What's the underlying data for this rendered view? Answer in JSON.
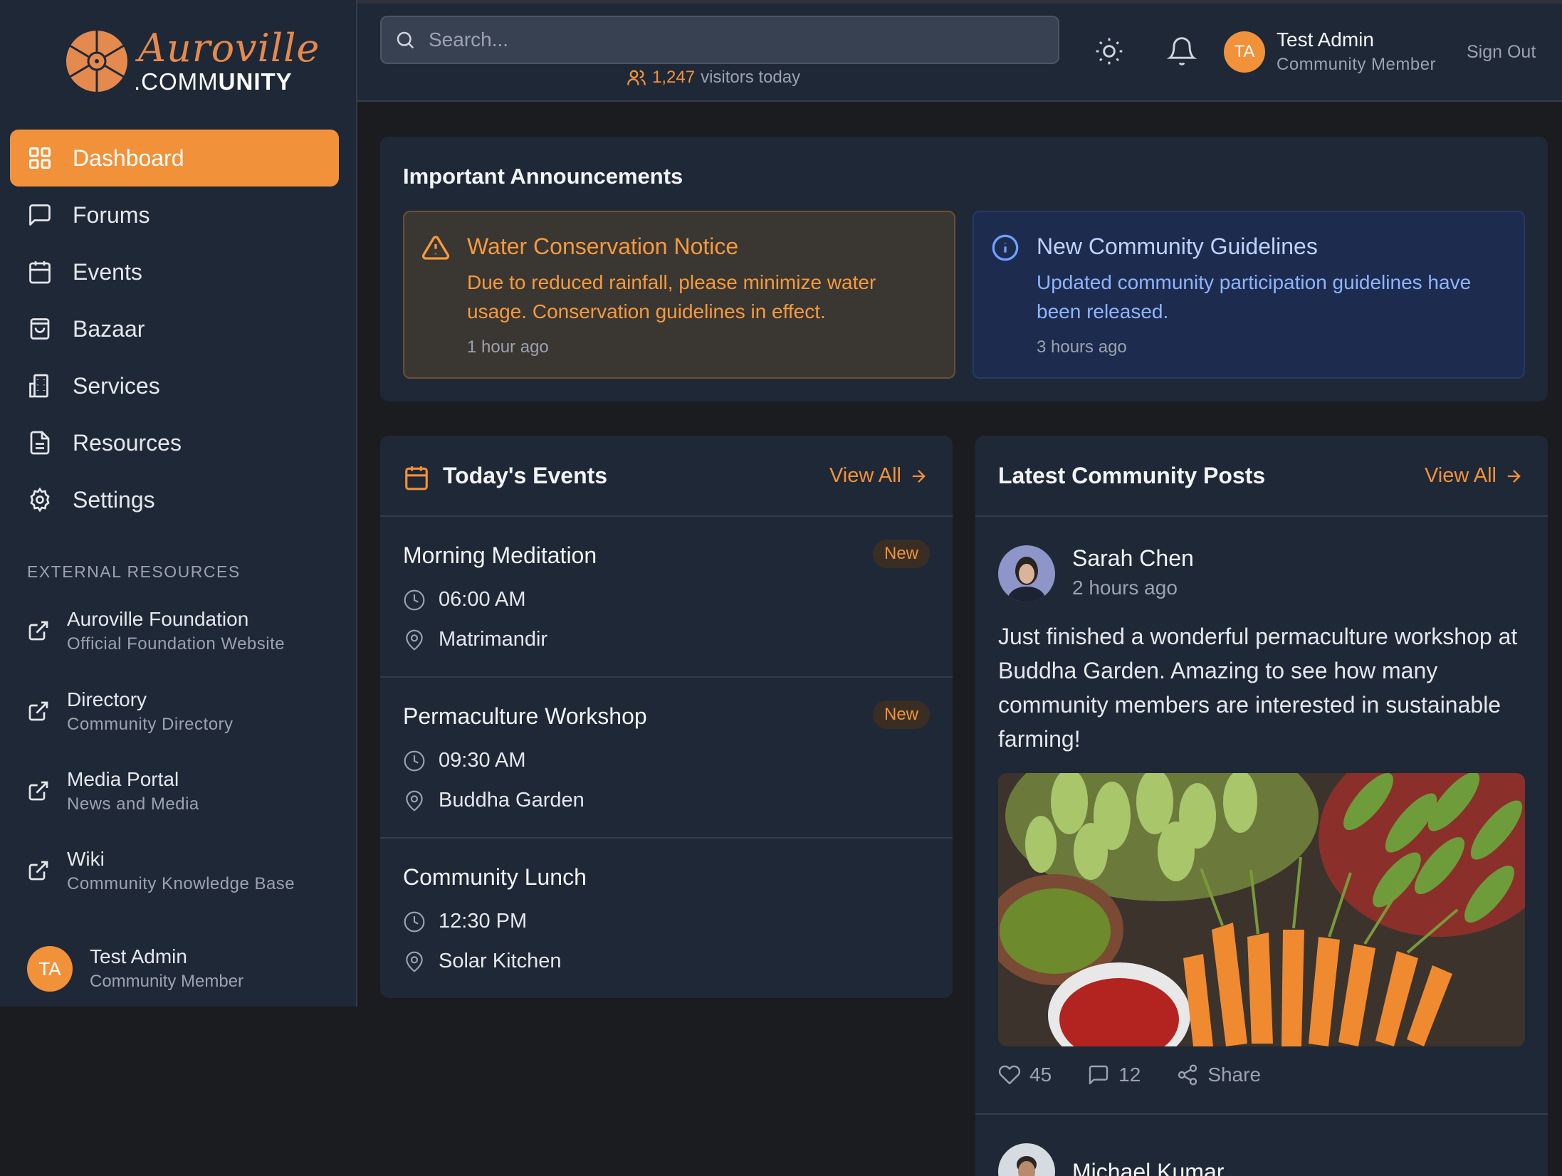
{
  "brand": {
    "logo_word": "Auroville",
    "logo_sub_prefix": ".COMM",
    "logo_sub_bold": "UNITY"
  },
  "colors": {
    "accent": "#f1923a",
    "sidebar_bg": "#1f2836",
    "page_bg": "#1b1c1f",
    "warning": "#f59a3e",
    "info": "#8fb4ff"
  },
  "sidebar": {
    "nav": [
      {
        "label": "Dashboard",
        "icon": "grid-icon",
        "active": true
      },
      {
        "label": "Forums",
        "icon": "message-square-icon"
      },
      {
        "label": "Events",
        "icon": "calendar-icon"
      },
      {
        "label": "Bazaar",
        "icon": "shopping-bag-icon"
      },
      {
        "label": "Services",
        "icon": "building-icon"
      },
      {
        "label": "Resources",
        "icon": "file-text-icon"
      },
      {
        "label": "Settings",
        "icon": "gear-icon"
      }
    ],
    "external_heading": "EXTERNAL RESOURCES",
    "external": [
      {
        "title": "Auroville Foundation",
        "subtitle": "Official Foundation Website",
        "icon": "external-link-icon"
      },
      {
        "title": "Directory",
        "subtitle": "Community Directory",
        "icon": "external-link-icon"
      },
      {
        "title": "Media Portal",
        "subtitle": "News and Media",
        "icon": "external-link-icon"
      },
      {
        "title": "Wiki",
        "subtitle": "Community Knowledge Base",
        "icon": "external-link-icon"
      }
    ],
    "user": {
      "initials": "TA",
      "name": "Test Admin",
      "role": "Community Member"
    }
  },
  "header": {
    "search_placeholder": "Search...",
    "visitors_count": "1,247",
    "visitors_label": "visitors today",
    "user": {
      "initials": "TA",
      "name": "Test Admin",
      "role": "Community Member"
    },
    "sign_out": "Sign Out"
  },
  "announcements": {
    "title": "Important Announcements",
    "items": [
      {
        "type": "warning",
        "title": "Water Conservation Notice",
        "description": "Due to reduced rainfall, please minimize water usage. Conservation guidelines in effect.",
        "time": "1 hour ago"
      },
      {
        "type": "info",
        "title": "New Community Guidelines",
        "description": "Updated community participation guidelines have been released.",
        "time": "3 hours ago"
      }
    ]
  },
  "events": {
    "title": "Today's Events",
    "view_all": "View All",
    "items": [
      {
        "name": "Morning Meditation",
        "time": "06:00 AM",
        "location": "Matrimandir",
        "badge": "New"
      },
      {
        "name": "Permaculture Workshop",
        "time": "09:30 AM",
        "location": "Buddha Garden",
        "badge": "New"
      },
      {
        "name": "Community Lunch",
        "time": "12:30 PM",
        "location": "Solar Kitchen",
        "badge": ""
      }
    ]
  },
  "posts": {
    "title": "Latest Community Posts",
    "view_all": "View All",
    "items": [
      {
        "author": "Sarah Chen",
        "time": "2 hours ago",
        "text": "Just finished a wonderful permaculture workshop at Buddha Garden. Amazing to see how many community members are interested in sustainable farming!",
        "likes": "45",
        "comments": "12",
        "share": "Share"
      },
      {
        "author": "Michael Kumar"
      }
    ]
  }
}
